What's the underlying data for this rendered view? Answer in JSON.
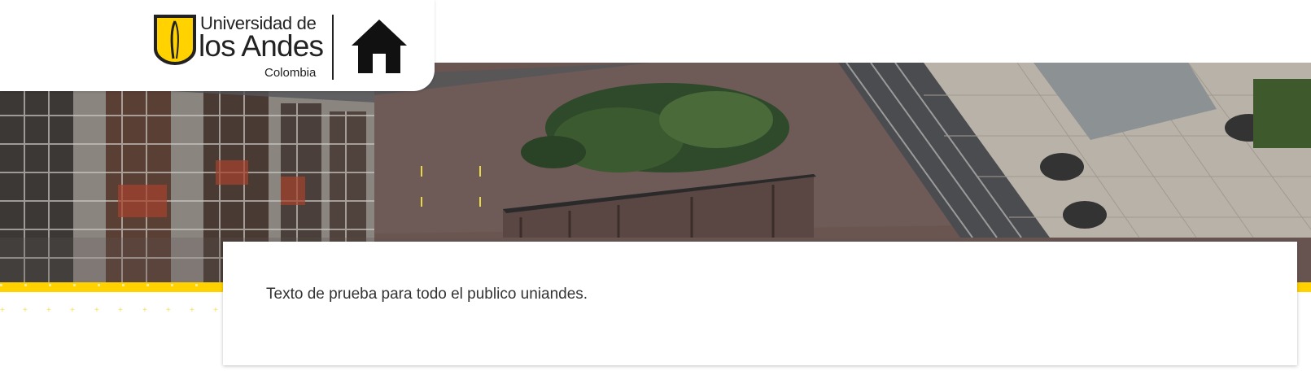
{
  "header": {
    "logo": {
      "line1": "Universidad de",
      "line2": "los Andes",
      "line3": "Colombia"
    },
    "home_icon": "home-icon"
  },
  "hero": {
    "description_icon": "campus-aerial-photo"
  },
  "content": {
    "text": "Texto de prueba para todo el publico uniandes."
  },
  "colors": {
    "accent": "#ffd200",
    "text": "#333333",
    "background": "#ffffff"
  }
}
